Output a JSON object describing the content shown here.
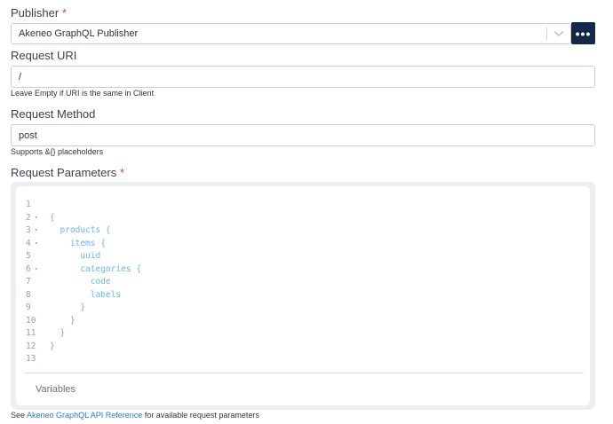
{
  "publisher": {
    "label": "Publisher",
    "required_mark": "*",
    "value": "Akeneo GraphQL Publisher",
    "more_label": "•••"
  },
  "request_uri": {
    "label": "Request URI",
    "value": "/",
    "hint": "Leave Empty if URI is the same in Client"
  },
  "request_method": {
    "label": "Request Method",
    "value": "post",
    "hint": "Supports &{} placeholders"
  },
  "request_parameters": {
    "label": "Request Parameters",
    "required_mark": "*",
    "code_lines": [
      {
        "num": "1",
        "fold": "",
        "indent": "",
        "text": "",
        "kind": "punct"
      },
      {
        "num": "2",
        "fold": "▾",
        "indent": "",
        "text": "{",
        "kind": "punct"
      },
      {
        "num": "3",
        "fold": "▾",
        "indent": "  ",
        "text": "products {",
        "kind": "field"
      },
      {
        "num": "4",
        "fold": "▾",
        "indent": "    ",
        "text": "items {",
        "kind": "field"
      },
      {
        "num": "5",
        "fold": "",
        "indent": "      ",
        "text": "uuid",
        "kind": "field"
      },
      {
        "num": "6",
        "fold": "▾",
        "indent": "      ",
        "text": "categories {",
        "kind": "field"
      },
      {
        "num": "7",
        "fold": "",
        "indent": "        ",
        "text": "code",
        "kind": "field"
      },
      {
        "num": "8",
        "fold": "",
        "indent": "        ",
        "text": "labels",
        "kind": "field"
      },
      {
        "num": "9",
        "fold": "",
        "indent": "      ",
        "text": "}",
        "kind": "punct"
      },
      {
        "num": "10",
        "fold": "",
        "indent": "    ",
        "text": "}",
        "kind": "punct"
      },
      {
        "num": "11",
        "fold": "",
        "indent": "  ",
        "text": "}",
        "kind": "punct"
      },
      {
        "num": "12",
        "fold": "",
        "indent": "",
        "text": "}",
        "kind": "punct"
      },
      {
        "num": "13",
        "fold": "",
        "indent": "",
        "text": "",
        "kind": "punct"
      }
    ],
    "variables_label": "Variables"
  },
  "footer": {
    "prefix": "See ",
    "link_text": "Akeneo GraphQL API Reference",
    "suffix": " for available request parameters"
  }
}
